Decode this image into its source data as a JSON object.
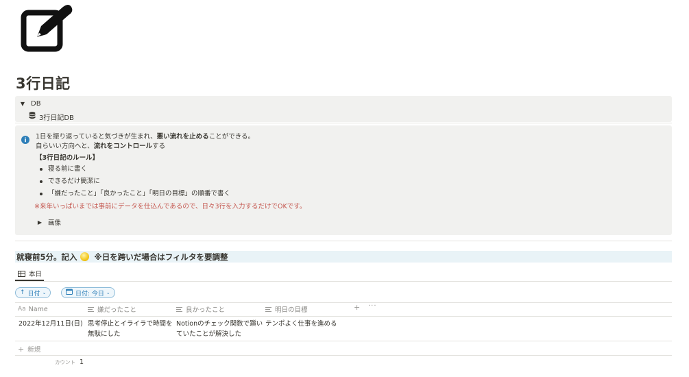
{
  "page": {
    "icon": "edit-square-pen-icon",
    "title": "3行日記"
  },
  "toggle": {
    "label": "DB",
    "db_link": "3行日記DB",
    "db_icon": "database-icon"
  },
  "callout": {
    "icon": "info-icon",
    "line1": {
      "a": "1日を振り返っていると気づきが生まれ、",
      "b": "悪い流れを止める",
      "c": "ことができる。"
    },
    "line2": {
      "a": "自らいい方向へと、",
      "b": "流れをコントロール",
      "c": "する"
    },
    "rules_heading": "【3行日記のルール】",
    "rules": [
      "寝る前に書く",
      "できるだけ簡潔に",
      "「嫌だったこと」「良かったこと」「明日の目標」の順番で書く"
    ],
    "note": "※来年いっぱいまでは事前にデータを仕込んであるので、日々3行を入力するだけでOKです。",
    "image_toggle": "画像",
    "note_color": "#c4554d"
  },
  "database": {
    "heading_before": "就寝前5分。記入",
    "heading_after": "※日を跨いだ場合はフィルタを要調整",
    "heading_bg": "#e9f3f7",
    "view_tab": "本日",
    "sort_pill": "日付",
    "filter_pill": "日付: 今日",
    "accent": "#2e7fb8",
    "columns": {
      "name": "Name",
      "bad": "嫌だったこと",
      "good": "良かったこと",
      "goal": "明日の目標"
    },
    "rows": [
      {
        "name": "2022年12月11日(日)",
        "bad": [
          "思考停止とイライラで時間を",
          "無駄にした"
        ],
        "good": [
          "Notionのチェック関数で躓い",
          "ていたことが解決した"
        ],
        "goal": "テンポよく仕事を進める"
      }
    ],
    "new_label": "新規",
    "count_label": "カウント",
    "count_value": "1"
  }
}
